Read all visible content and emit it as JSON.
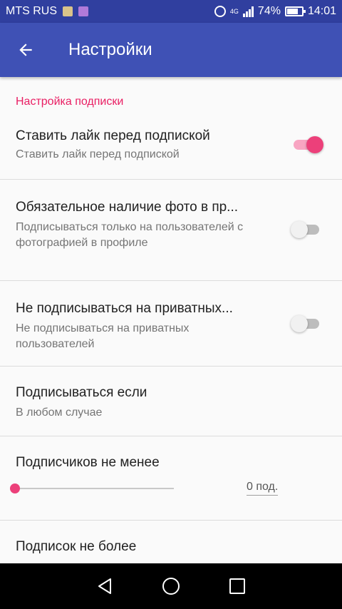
{
  "status_bar": {
    "carrier": "MTS RUS",
    "network": "4G",
    "battery": "74%",
    "battery_level": 0.74,
    "time": "14:01"
  },
  "app_bar": {
    "title": "Настройки",
    "back_icon": "arrow-back-icon"
  },
  "section": {
    "title": "Настройка подписки"
  },
  "prefs": [
    {
      "title": "Ставить лайк перед подпиской",
      "summary": "Ставить лайк перед подпиской",
      "enabled": true
    },
    {
      "title": "Обязательное наличие фото в пр...",
      "summary": "Подписываться только на пользователей с фотографией в профиле",
      "enabled": false
    },
    {
      "title": "Не подписываться на приватных...",
      "summary": "Не подписываться на приватных пользователей",
      "enabled": false
    },
    {
      "title": "Подписываться если",
      "summary": "В любом случае"
    },
    {
      "title": "Подписчиков не менее",
      "slider_value": "0 под.",
      "slider_fraction": 0
    },
    {
      "title": "Подписок не более"
    }
  ],
  "nav_bar": {
    "back": "nav-back-icon",
    "home": "nav-home-icon",
    "recents": "nav-recents-icon"
  },
  "colors": {
    "primary": "#3f51b5",
    "primary_dark": "#303f9f",
    "accent": "#ec407a"
  }
}
